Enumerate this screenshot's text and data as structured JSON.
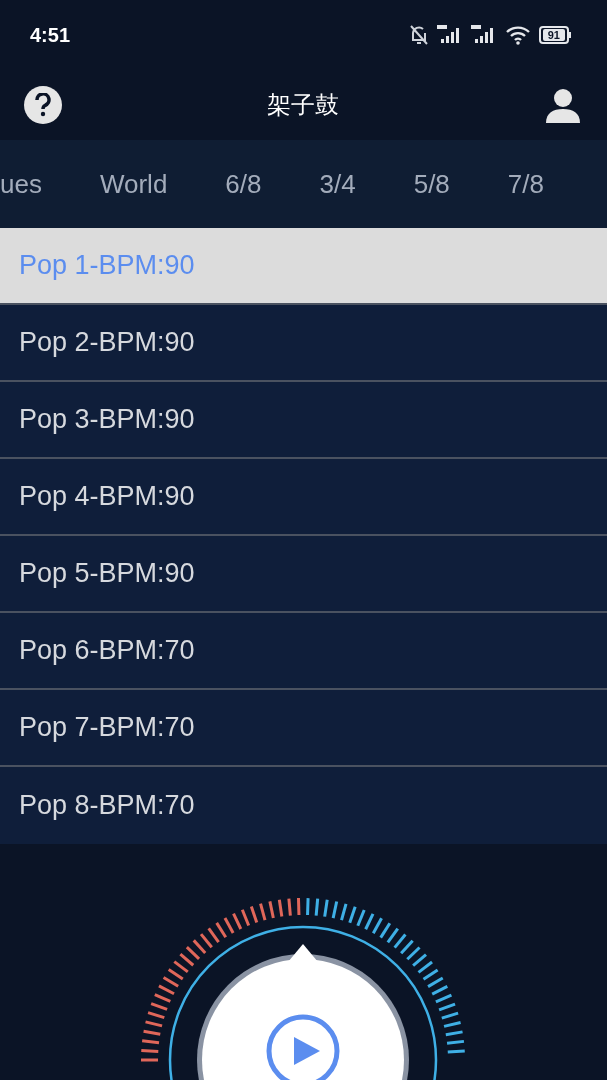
{
  "status_bar": {
    "time": "4:51",
    "battery": "91"
  },
  "header": {
    "title": "架子鼓"
  },
  "tabs": [
    {
      "label": "ues",
      "selected": false
    },
    {
      "label": "World",
      "selected": false
    },
    {
      "label": "6/8",
      "selected": false
    },
    {
      "label": "3/4",
      "selected": false
    },
    {
      "label": "5/8",
      "selected": false
    },
    {
      "label": "7/8",
      "selected": false
    }
  ],
  "patterns": [
    {
      "label": "Pop 1-BPM:90",
      "selected": true
    },
    {
      "label": "Pop 2-BPM:90",
      "selected": false
    },
    {
      "label": "Pop 3-BPM:90",
      "selected": false
    },
    {
      "label": "Pop 4-BPM:90",
      "selected": false
    },
    {
      "label": "Pop 5-BPM:90",
      "selected": false
    },
    {
      "label": "Pop 6-BPM:70",
      "selected": false
    },
    {
      "label": "Pop 7-BPM:70",
      "selected": false
    },
    {
      "label": "Pop 8-BPM:70",
      "selected": false
    }
  ]
}
